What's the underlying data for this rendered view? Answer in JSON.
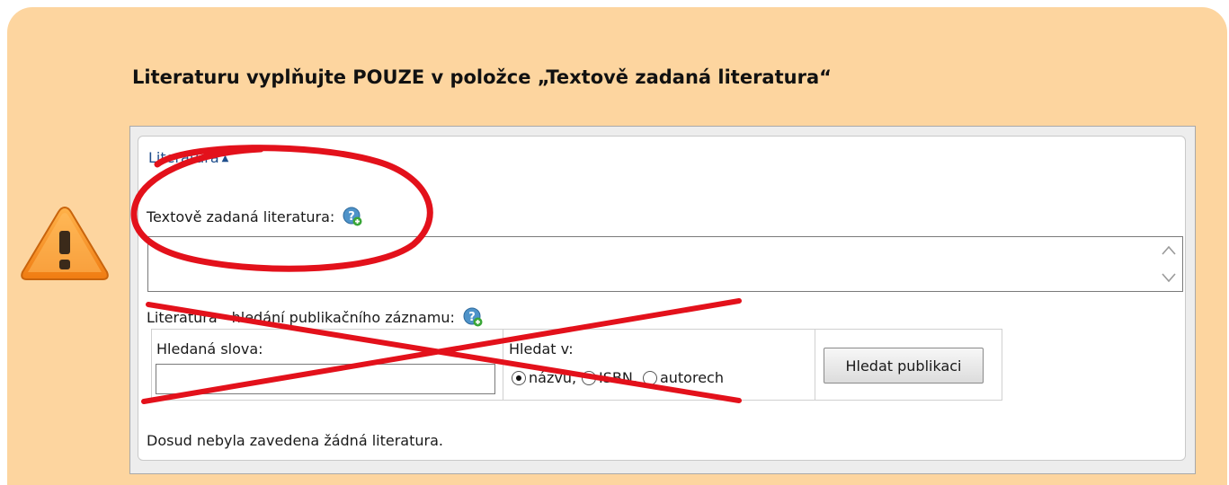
{
  "note": {
    "title": "Literaturu vyplňujte POUZE v položce „Textově zadaná literatura“",
    "background_color": "#fdd59f",
    "warning_icon": "warning-triangle-icon"
  },
  "form": {
    "section_link": "Literatura",
    "section_caret": "▲",
    "text_literature_label": "Textově zadaná literatura:",
    "text_literature_value": "",
    "search_label": "Literatura - hledání publikačního záznamu:",
    "search_words_label": "Hledaná slova:",
    "search_words_value": "",
    "search_in_label": "Hledat v:",
    "radio_options": [
      {
        "label": "názvu,",
        "checked": true
      },
      {
        "label": "ISBN,",
        "checked": false
      },
      {
        "label": "autorech",
        "checked": false
      }
    ],
    "search_button": "Hledat publikaci",
    "empty_message": "Dosud nebyla zavedena žádná literatura.",
    "help_icon": "help-add-icon"
  },
  "annotations": {
    "circle_color": "#e3111b",
    "cross_color": "#e3111b"
  }
}
